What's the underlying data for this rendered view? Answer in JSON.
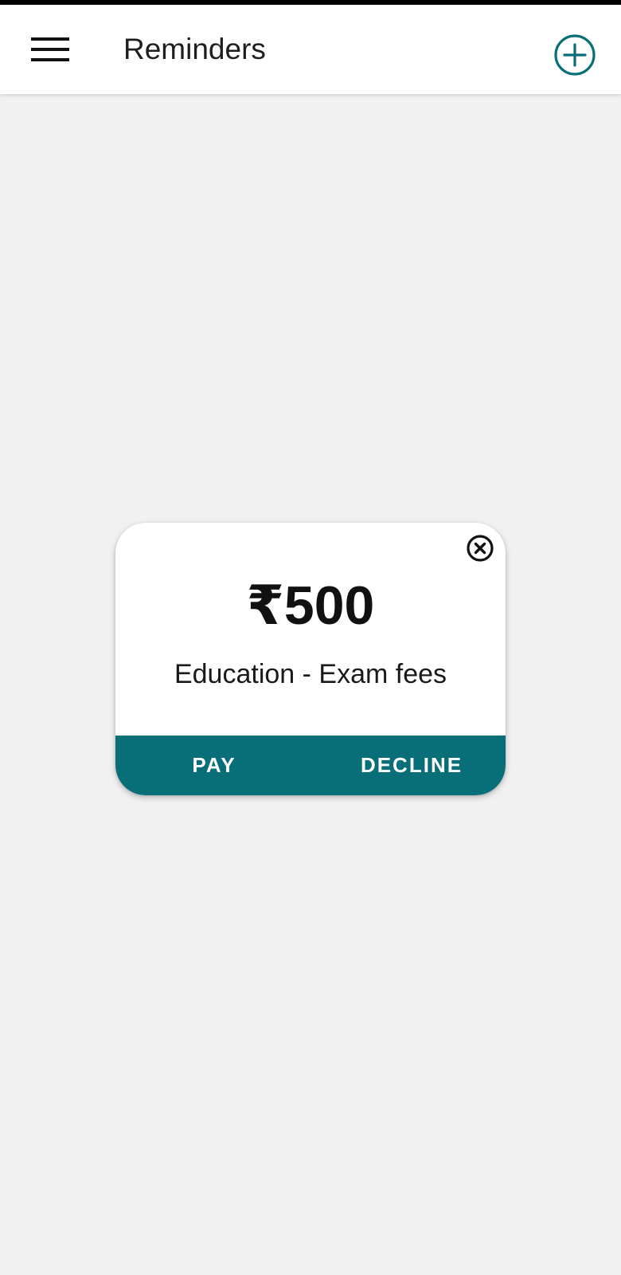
{
  "app_bar": {
    "title": "Reminders",
    "menu_icon": "hamburger-menu-icon",
    "add_icon": "add-circle-icon"
  },
  "reminder_card": {
    "amount": "₹500",
    "description": "Education - Exam fees",
    "close_icon": "close-circle-icon",
    "actions": {
      "pay_label": "PAY",
      "decline_label": "DECLINE"
    }
  },
  "colors": {
    "accent": "#086f78",
    "background": "#f1f1f1",
    "surface": "#ffffff",
    "title_text": "#1e1e1e"
  }
}
